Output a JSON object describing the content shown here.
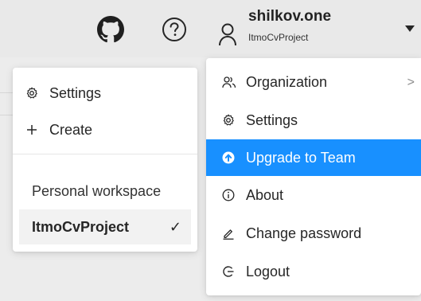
{
  "header": {
    "github_icon": "github-icon",
    "help_icon": "help-circle-icon",
    "user_icon": "user-icon",
    "user_name": "shilkov.one",
    "project_name": "ItmoCvProject",
    "caret_icon": "caret-down-icon"
  },
  "left_menu": {
    "items": [
      {
        "icon": "gear-icon",
        "label": "Settings"
      },
      {
        "icon": "plus-icon",
        "label": "Create"
      }
    ],
    "workspace_heading": "Personal workspace",
    "workspace_selected": "ItmoCvProject",
    "check_glyph": "✓"
  },
  "right_menu": {
    "items": [
      {
        "icon": "organization-icon",
        "label": "Organization",
        "has_submenu": true
      },
      {
        "icon": "gear-icon",
        "label": "Settings"
      },
      {
        "icon": "arrow-up-circle-icon",
        "label": "Upgrade to Team",
        "highlighted": true
      },
      {
        "icon": "info-icon",
        "label": "About"
      },
      {
        "icon": "pencil-icon",
        "label": "Change password"
      },
      {
        "icon": "logout-icon",
        "label": "Logout"
      }
    ],
    "submenu_chevron": ">"
  },
  "colors": {
    "accent": "#1890ff",
    "topbar": "#e9e9e9",
    "menu_bg": "#ffffff"
  }
}
